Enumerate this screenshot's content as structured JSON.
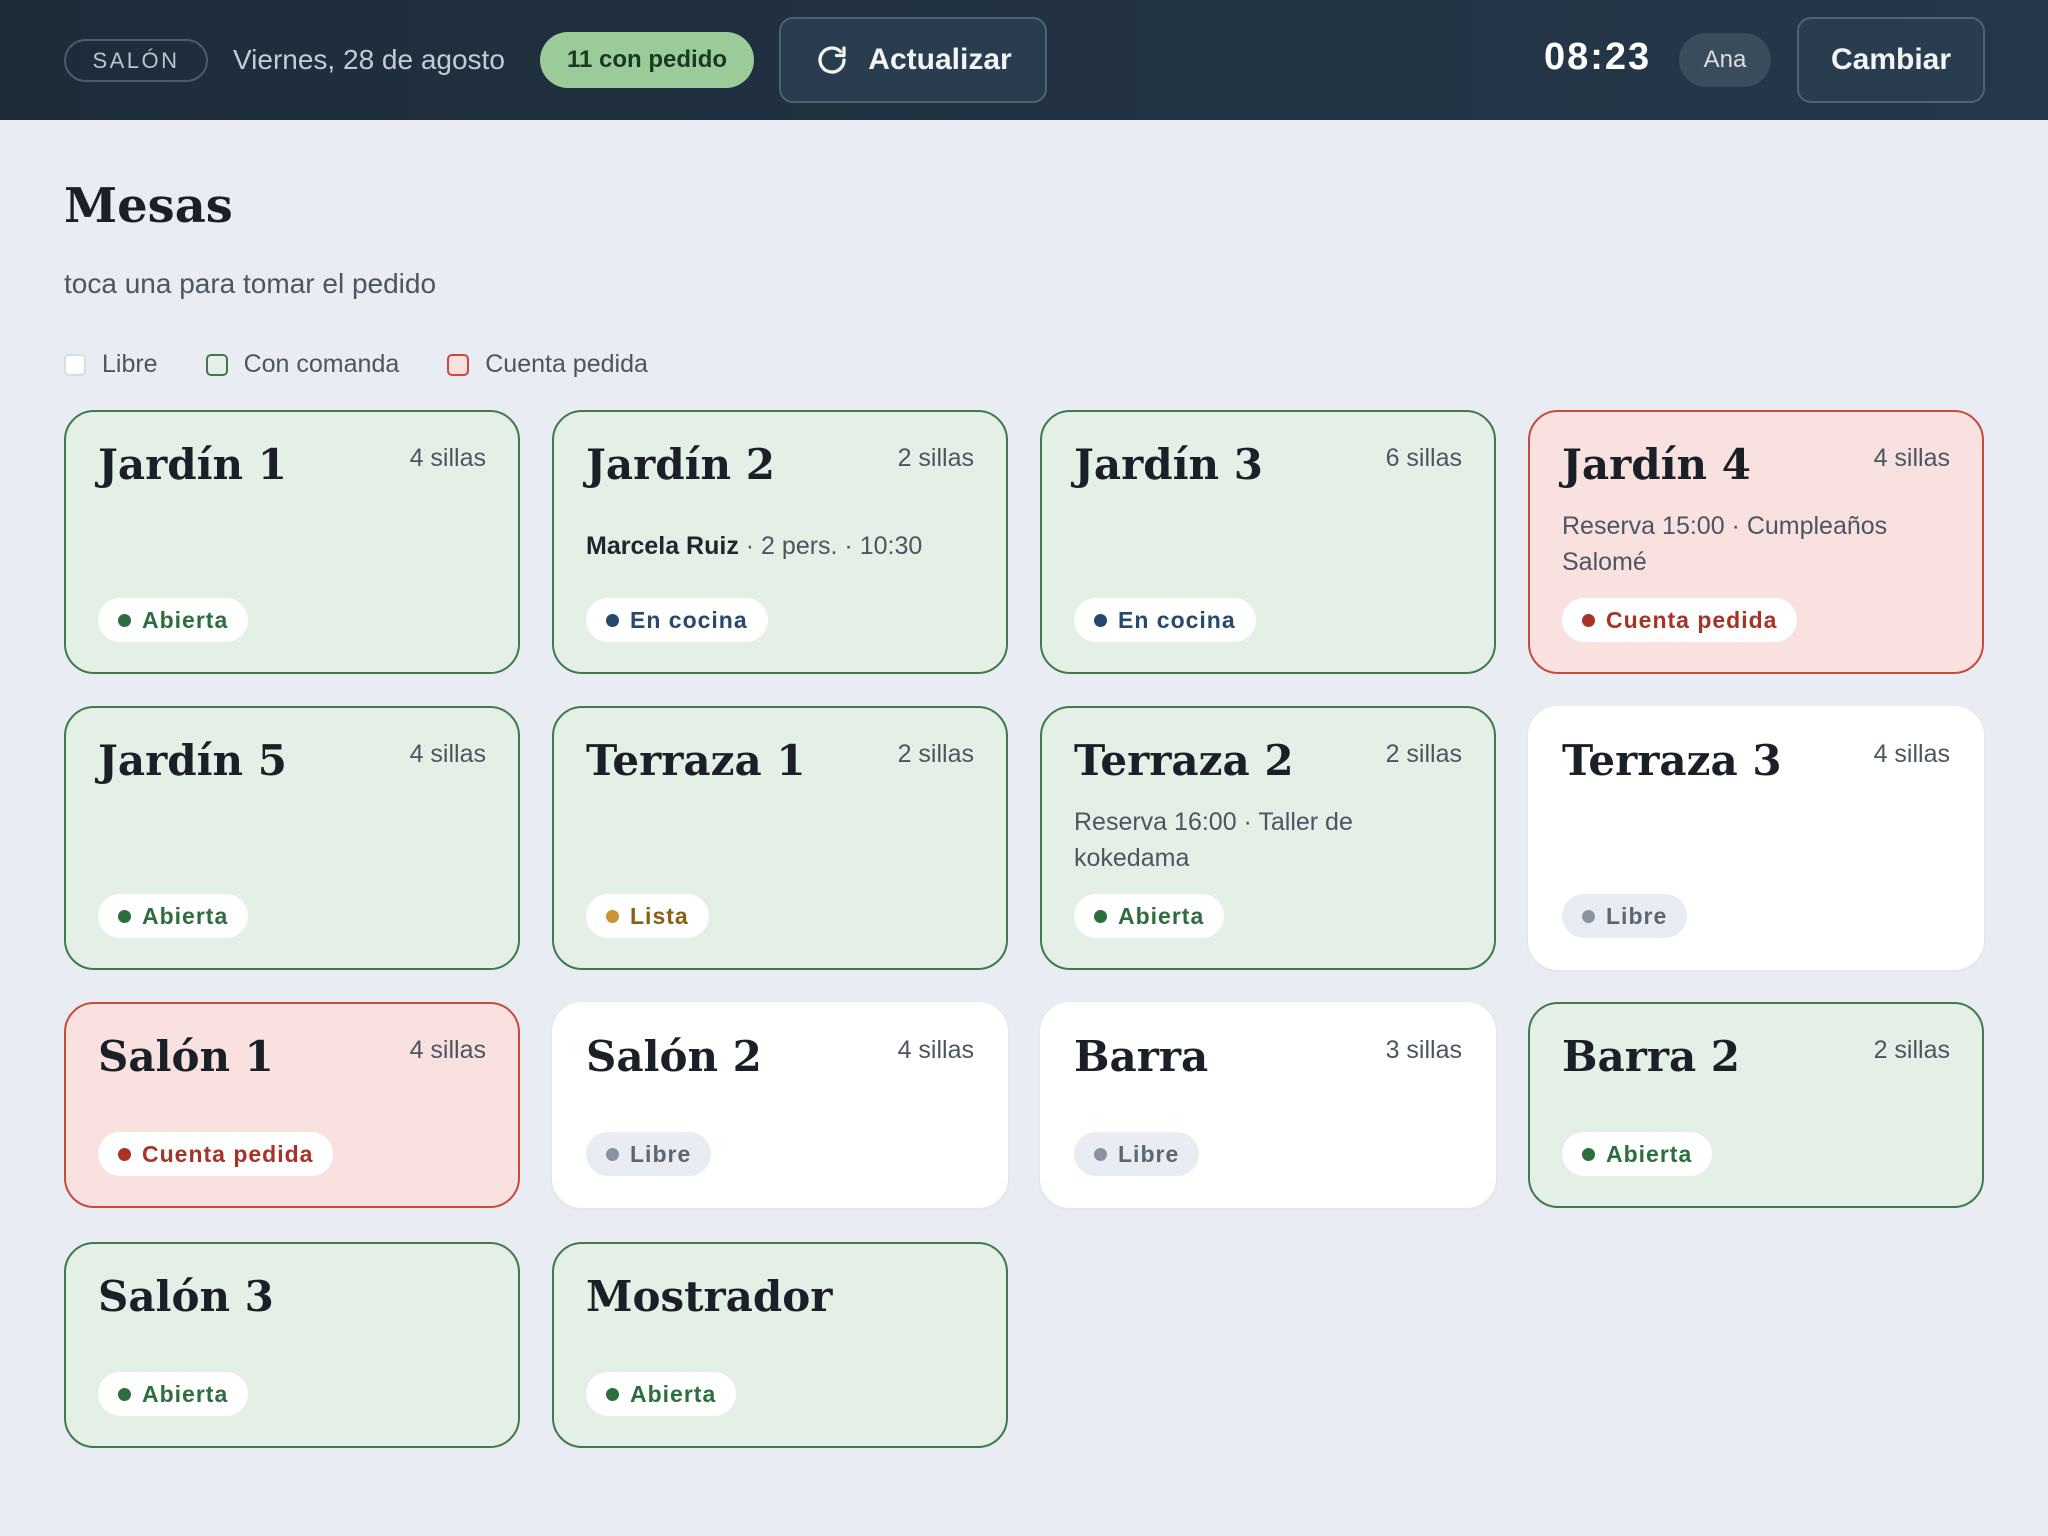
{
  "header": {
    "section": "SALÓN",
    "date": "Viernes, 28 de agosto",
    "orders_badge": "11 con pedido",
    "refresh_label": "Actualizar",
    "time": "08:23",
    "user": "Ana",
    "switch_label": "Cambiar"
  },
  "page": {
    "title": "Mesas",
    "subtitle": "toca una para tomar el pedido"
  },
  "legend": [
    {
      "label": "Libre",
      "state": "libre"
    },
    {
      "label": "Con comanda",
      "state": "comanda"
    },
    {
      "label": "Cuenta pedida",
      "state": "cuenta"
    }
  ],
  "colors": {
    "comanda_bg": "#e4efe5",
    "comanda_border": "#3f7a4c",
    "cuenta_bg": "#f8e1de",
    "cuenta_border": "#c94a3a",
    "libre_bg": "#ffffff",
    "header_bg": "#1e2c3a",
    "badge_green": "#9ccb9a"
  },
  "tables": [
    {
      "name": "Jardín 1",
      "seats": "4 sillas",
      "state": "comanda",
      "status": "Abierta",
      "status_kind": "abierta"
    },
    {
      "name": "Jardín 2",
      "seats": "2 sillas",
      "state": "comanda",
      "guest": "Marcela Ruiz",
      "guest_detail": " · 2 pers. · 10:30",
      "status": "En cocina",
      "status_kind": "cocina"
    },
    {
      "name": "Jardín 3",
      "seats": "6 sillas",
      "state": "comanda",
      "status": "En cocina",
      "status_kind": "cocina"
    },
    {
      "name": "Jardín 4",
      "seats": "4 sillas",
      "state": "cuenta",
      "note": "Reserva 15:00 · Cumpleaños Salomé",
      "status": "Cuenta pedida",
      "status_kind": "cuenta"
    },
    {
      "name": "Jardín 5",
      "seats": "4 sillas",
      "state": "comanda",
      "status": "Abierta",
      "status_kind": "abierta"
    },
    {
      "name": "Terraza 1",
      "seats": "2 sillas",
      "state": "comanda",
      "status": "Lista",
      "status_kind": "lista"
    },
    {
      "name": "Terraza 2",
      "seats": "2 sillas",
      "state": "comanda",
      "note": "Reserva 16:00 · Taller de kokedama",
      "status": "Abierta",
      "status_kind": "abierta"
    },
    {
      "name": "Terraza 3",
      "seats": "4 sillas",
      "state": "libre",
      "status": "Libre",
      "status_kind": "libre"
    },
    {
      "name": "Salón 1",
      "seats": "4 sillas",
      "state": "cuenta",
      "status": "Cuenta pedida",
      "status_kind": "cuenta"
    },
    {
      "name": "Salón 2",
      "seats": "4 sillas",
      "state": "libre",
      "status": "Libre",
      "status_kind": "libre"
    },
    {
      "name": "Barra",
      "seats": "3 sillas",
      "state": "libre",
      "status": "Libre",
      "status_kind": "libre"
    },
    {
      "name": "Barra 2",
      "seats": "2 sillas",
      "state": "comanda",
      "status": "Abierta",
      "status_kind": "abierta"
    },
    {
      "name": "Salón 3",
      "seats": "",
      "state": "comanda",
      "status": "Abierta",
      "status_kind": "abierta"
    },
    {
      "name": "Mostrador",
      "seats": "",
      "state": "comanda",
      "status": "Abierta",
      "status_kind": "abierta"
    }
  ]
}
